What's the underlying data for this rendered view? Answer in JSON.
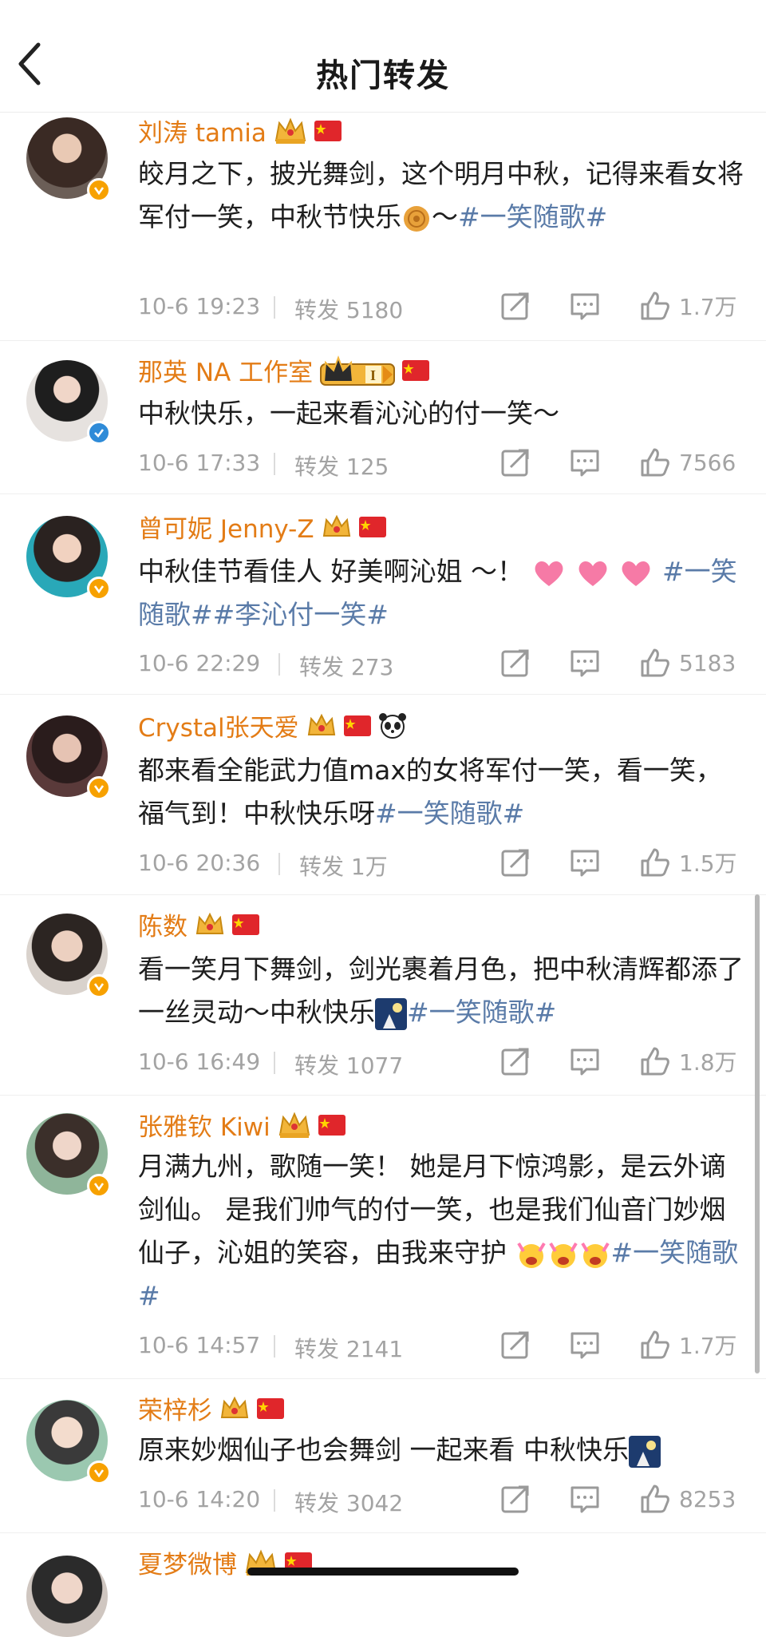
{
  "header": {
    "title": "热门转发"
  },
  "posts": [
    {
      "user": "刘涛 tamia",
      "text": "皎月之下，披光舞剑，这个明月中秋，记得来看女将军付一笑，中秋节快乐",
      "emoji": "mooncake",
      "tilde": "～",
      "hashtags": "#一笑随歌#",
      "time": "10-6 19:23",
      "repost_label": "转发",
      "repost_count": "5180",
      "likes": "1.7万"
    },
    {
      "user": "那英 NA 工作室",
      "text": "中秋快乐，一起来看沁沁的付一笑～",
      "time": "10-6 17:33",
      "repost_label": "转发",
      "repost_count": "125",
      "likes": "7566"
    },
    {
      "user": "曾可妮 Jenny-Z",
      "text": "中秋佳节看佳人 好美啊沁姐 ～！",
      "hashtags": "#一笑随歌##李沁付一笑#",
      "time": "10-6 22:29",
      "repost_label": "转发",
      "repost_count": "273",
      "likes": "5183"
    },
    {
      "user": "Crystal张天爱",
      "text": "都来看全能武力值max的女将军付一笑，看一笑，福气到！中秋快乐呀",
      "hashtags": "#一笑随歌#",
      "time": "10-6 20:36",
      "repost_label": "转发",
      "repost_count": "1万",
      "likes": "1.5万"
    },
    {
      "user": "陈数",
      "text": "看一笑月下舞剑，剑光裹着月色，把中秋清辉都添了一丝灵动～中秋快乐",
      "hashtags": "#一笑随歌#",
      "time": "10-6 16:49",
      "repost_label": "转发",
      "repost_count": "1077",
      "likes": "1.8万"
    },
    {
      "user": "张雅钦 Kiwi",
      "text": "月满九州，歌随一笑！ 她是月下惊鸿影，是云外谪剑仙。 是我们帅气的付一笑，也是我们仙音门妙烟仙子，沁姐的笑容，由我来守护",
      "hashtags": "#一笑随歌#",
      "time": "10-6 14:57",
      "repost_label": "转发",
      "repost_count": "2141",
      "likes": "1.7万"
    },
    {
      "user": "荣梓杉",
      "text": "原来妙烟仙子也会舞剑 一起来看 中秋快乐",
      "time": "10-6 14:20",
      "repost_label": "转发",
      "repost_count": "3042",
      "likes": "8253"
    },
    {
      "user": "夏梦微博"
    }
  ],
  "colors": {
    "username": "#e37c16",
    "hashtag": "#5a7ba8",
    "meta": "#a3a3a3",
    "verify_orange": "#f7a100",
    "verify_blue": "#2f8bd8"
  }
}
